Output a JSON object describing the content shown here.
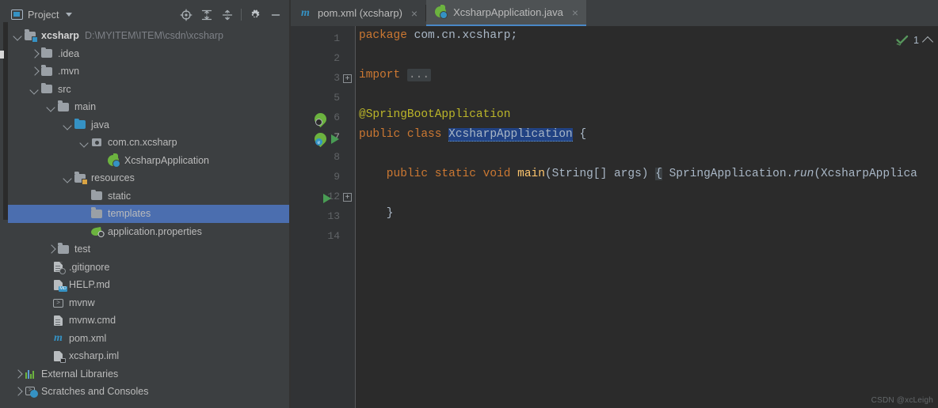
{
  "window": {
    "background": "#3c3f41",
    "editor_background": "#2b2b2b",
    "accent": "#4b6eaf",
    "tab_underline": "#4a88c7"
  },
  "project_panel": {
    "title": "Project",
    "title_icon": "project-window-icon",
    "dropdown_icon": "chevron-down-icon",
    "toolbar_buttons": [
      {
        "name": "locate-icon",
        "label": "Select Opened File"
      },
      {
        "name": "expand-all-icon",
        "label": "Expand All"
      },
      {
        "name": "collapse-all-icon",
        "label": "Collapse All"
      },
      {
        "name": "gear-icon",
        "label": "Settings"
      },
      {
        "name": "minimize-icon",
        "label": "Hide"
      }
    ],
    "tree": [
      {
        "label": "xcsharp",
        "path": "D:\\MYITEM\\ITEM\\csdn\\xcsharp",
        "depth": 0,
        "twisty": "open",
        "icon": "module-folder-icon",
        "bold": true,
        "selected": false
      },
      {
        "label": ".idea",
        "path": "",
        "depth": 1,
        "twisty": "closed",
        "icon": "folder-icon",
        "bold": false,
        "selected": false
      },
      {
        "label": ".mvn",
        "path": "",
        "depth": 1,
        "twisty": "closed",
        "icon": "folder-icon",
        "bold": false,
        "selected": false
      },
      {
        "label": "src",
        "path": "",
        "depth": 1,
        "twisty": "open",
        "icon": "folder-icon",
        "bold": false,
        "selected": false
      },
      {
        "label": "main",
        "path": "",
        "depth": 2,
        "twisty": "open",
        "icon": "folder-icon",
        "bold": false,
        "selected": false
      },
      {
        "label": "java",
        "path": "",
        "depth": 3,
        "twisty": "open",
        "icon": "source-root-folder-icon",
        "bold": false,
        "selected": false
      },
      {
        "label": "com.cn.xcsharp",
        "path": "",
        "depth": 4,
        "twisty": "open",
        "icon": "package-icon",
        "bold": false,
        "selected": false
      },
      {
        "label": "XcsharpApplication",
        "path": "",
        "depth": 5,
        "twisty": "none",
        "icon": "spring-boot-class-icon",
        "bold": false,
        "selected": false
      },
      {
        "label": "resources",
        "path": "",
        "depth": 3,
        "twisty": "open",
        "icon": "resource-root-folder-icon",
        "bold": false,
        "selected": false
      },
      {
        "label": "static",
        "path": "",
        "depth": 4,
        "twisty": "none",
        "icon": "folder-icon",
        "bold": false,
        "selected": false
      },
      {
        "label": "templates",
        "path": "",
        "depth": 4,
        "twisty": "none",
        "icon": "folder-icon",
        "bold": false,
        "selected": true
      },
      {
        "label": "application.properties",
        "path": "",
        "depth": 4,
        "twisty": "none",
        "icon": "spring-properties-icon",
        "bold": false,
        "selected": false
      },
      {
        "label": "test",
        "path": "",
        "depth": 2,
        "twisty": "closed",
        "icon": "folder-icon",
        "bold": false,
        "selected": false
      },
      {
        "label": ".gitignore",
        "path": "",
        "depth": 2,
        "twisty": "none",
        "icon": "gitignore-file-icon",
        "bold": false,
        "selected": false
      },
      {
        "label": "HELP.md",
        "path": "",
        "depth": 2,
        "twisty": "none",
        "icon": "markdown-file-icon",
        "bold": false,
        "selected": false
      },
      {
        "label": "mvnw",
        "path": "",
        "depth": 2,
        "twisty": "none",
        "icon": "shell-script-icon",
        "bold": false,
        "selected": false
      },
      {
        "label": "mvnw.cmd",
        "path": "",
        "depth": 2,
        "twisty": "none",
        "icon": "text-file-icon",
        "bold": false,
        "selected": false
      },
      {
        "label": "pom.xml",
        "path": "",
        "depth": 2,
        "twisty": "none",
        "icon": "maven-file-icon",
        "bold": false,
        "selected": false
      },
      {
        "label": "xcsharp.iml",
        "path": "",
        "depth": 2,
        "twisty": "none",
        "icon": "iml-file-icon",
        "bold": false,
        "selected": false
      },
      {
        "label": "External Libraries",
        "path": "",
        "depth": 0,
        "twisty": "closed",
        "icon": "external-libraries-icon",
        "bold": false,
        "selected": false
      },
      {
        "label": "Scratches and Consoles",
        "path": "",
        "depth": 0,
        "twisty": "closed",
        "icon": "scratches-icon",
        "bold": false,
        "selected": false
      }
    ]
  },
  "editor": {
    "tabs": [
      {
        "label": "pom.xml (xcsharp)",
        "icon": "maven-file-icon",
        "active": false,
        "close_glyph": "×"
      },
      {
        "label": "XcsharpApplication.java",
        "icon": "spring-boot-class-icon",
        "active": true,
        "close_glyph": "×"
      }
    ],
    "line_numbers": [
      "1",
      "2",
      "3",
      "5",
      "6",
      "7",
      "8",
      "9",
      "12",
      "13",
      "14"
    ],
    "code_lines": [
      {
        "num": "1",
        "segments": [
          {
            "text": "package",
            "style": "kw"
          },
          {
            "text": " com.cn.xcsharp;",
            "style": "ident"
          }
        ]
      },
      {
        "num": "2",
        "segments": []
      },
      {
        "num": "3",
        "segments": [
          {
            "text": "import",
            "style": "kw"
          },
          {
            "text": " ",
            "style": "ident"
          },
          {
            "text": "...",
            "style": "fold"
          }
        ]
      },
      {
        "num": "5",
        "segments": []
      },
      {
        "num": "6",
        "segments": [
          {
            "text": "@SpringBootApplication",
            "style": "ann"
          }
        ]
      },
      {
        "num": "7",
        "segments": [
          {
            "text": "public class ",
            "style": "kw"
          },
          {
            "text": "XcsharpApplication",
            "style": "selected-ident"
          },
          {
            "text": " {",
            "style": "ident"
          }
        ]
      },
      {
        "num": "8",
        "segments": []
      },
      {
        "num": "9",
        "segments": [
          {
            "text": "    public static void ",
            "style": "kw"
          },
          {
            "text": "main",
            "style": "meth"
          },
          {
            "text": "(String[] args) ",
            "style": "ident"
          },
          {
            "text": "{",
            "style": "brace-hl"
          },
          {
            "text": " SpringApplication.",
            "style": "ident"
          },
          {
            "text": "run",
            "style": "italic-ident"
          },
          {
            "text": "(XcsharpApplica",
            "style": "ident"
          }
        ]
      },
      {
        "num": "12",
        "segments": []
      },
      {
        "num": "13",
        "segments": [
          {
            "text": "    }",
            "style": "ident"
          }
        ]
      },
      {
        "num": "14",
        "segments": []
      }
    ],
    "gutter_markers": [
      {
        "line": "3",
        "type": "fold-plus",
        "glyph": "+"
      },
      {
        "line": "6",
        "type": "spring-bean-icon"
      },
      {
        "line": "7",
        "type": "spring-bean-config-icon"
      },
      {
        "line": "7",
        "type": "run-arrow-icon"
      },
      {
        "line": "9",
        "type": "run-arrow-icon"
      },
      {
        "line": "9",
        "type": "fold-plus",
        "glyph": "+"
      }
    ],
    "inspection_widget": {
      "status_icon": "inspection-ok-icon",
      "count": "1",
      "collapse_icon": "chevron-up-icon"
    }
  },
  "watermark": {
    "text": "CSDN @xcLeigh"
  }
}
